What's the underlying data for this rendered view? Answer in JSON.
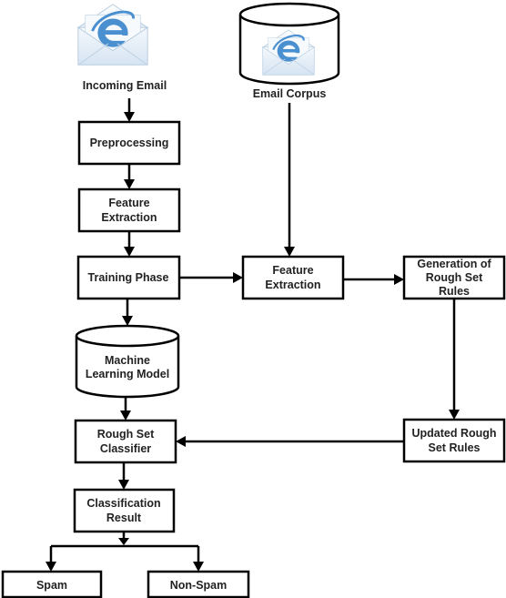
{
  "diagram": {
    "type": "flowchart",
    "colors": {
      "stroke": "#000000",
      "text": "#222222",
      "icon_blue": "#4a90d0",
      "envelope": "#e8f0f8"
    },
    "nodes": {
      "incoming_email": {
        "label": "Incoming Email",
        "icon": "email-envelope-ie-icon"
      },
      "email_corpus": {
        "label": "Email Corpus",
        "icon": "email-envelope-ie-icon",
        "shape": "database-cylinder"
      },
      "preprocessing": {
        "label": "Preprocessing"
      },
      "feature_extraction_left": {
        "line1": "Feature",
        "line2": "Extraction"
      },
      "training_phase": {
        "label": "Training Phase"
      },
      "feature_extraction_mid": {
        "line1": "Feature",
        "line2": "Extraction"
      },
      "generation_rules": {
        "line1": "Generation of",
        "line2": "Rough Set",
        "line3": "Rules"
      },
      "ml_model": {
        "line1": "Machine",
        "line2": "Learning Model",
        "shape": "database-cylinder"
      },
      "rough_set_classifier": {
        "line1": "Rough Set",
        "line2": "Classifier"
      },
      "updated_rules": {
        "line1": "Updated Rough",
        "line2": "Set Rules"
      },
      "classification_result": {
        "line1": "Classification",
        "line2": "Result"
      },
      "spam": {
        "label": "Spam"
      },
      "non_spam": {
        "label": "Non-Spam"
      }
    },
    "edges": [
      {
        "from": "incoming_email",
        "to": "preprocessing"
      },
      {
        "from": "preprocessing",
        "to": "feature_extraction_left"
      },
      {
        "from": "feature_extraction_left",
        "to": "training_phase"
      },
      {
        "from": "training_phase",
        "to": "feature_extraction_mid"
      },
      {
        "from": "email_corpus",
        "to": "feature_extraction_mid"
      },
      {
        "from": "feature_extraction_mid",
        "to": "generation_rules"
      },
      {
        "from": "training_phase",
        "to": "ml_model"
      },
      {
        "from": "ml_model",
        "to": "rough_set_classifier"
      },
      {
        "from": "generation_rules",
        "to": "updated_rules"
      },
      {
        "from": "updated_rules",
        "to": "rough_set_classifier"
      },
      {
        "from": "rough_set_classifier",
        "to": "classification_result"
      },
      {
        "from": "classification_result",
        "to": "spam"
      },
      {
        "from": "classification_result",
        "to": "non_spam"
      }
    ]
  }
}
